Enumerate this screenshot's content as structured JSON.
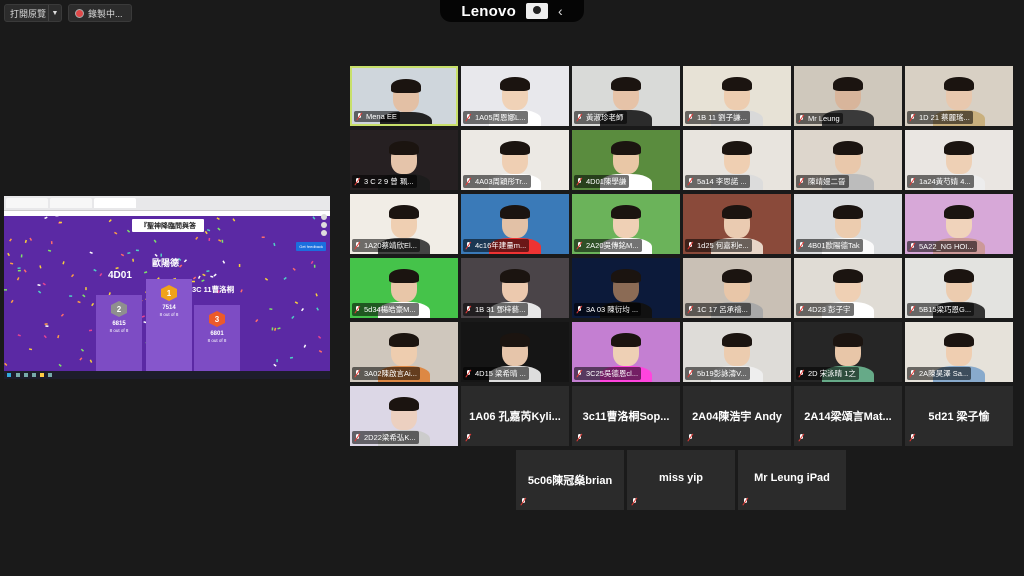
{
  "toolbar": {
    "view_options_label": "打開原覽",
    "recording_label": "錄製中..."
  },
  "lenovo": {
    "brand": "Lenovo"
  },
  "shared_screen": {
    "question": "『聖神降臨問與答",
    "get_feedback": "Get feedback",
    "podiums": [
      {
        "rank": "2",
        "name": "4D01",
        "score": "6815",
        "detail": "8 out of 8",
        "color": "#8f8f8f"
      },
      {
        "rank": "1",
        "name": "歐陽德",
        "score": "7514",
        "detail": "8 out of 8",
        "color": "#f0a21a"
      },
      {
        "rank": "3",
        "name": "3C 11曹洛桐",
        "score": "6801",
        "detail": "8 out of 8",
        "color": "#ec5a2a"
      }
    ]
  },
  "participants": [
    {
      "name": "Mena EE",
      "video": true,
      "active": true,
      "bg": "#cfd6dc",
      "skin": "#e3c0a5",
      "shirt": "#222"
    },
    {
      "name": "1A05周恩娜L...",
      "video": true,
      "bg": "#e8e8ec",
      "skin": "#f0d2b7",
      "shirt": "#fff"
    },
    {
      "name": "黃淑珍老師",
      "video": true,
      "bg": "#d9dad8",
      "skin": "#e6c3a8",
      "shirt": "#2b2b2b"
    },
    {
      "name": "1B 11 劉子謙...",
      "video": true,
      "bg": "#e7e2d6",
      "skin": "#edcdb0",
      "shirt": "#d9d9d9"
    },
    {
      "name": "Mr Leung",
      "video": true,
      "bg": "#cfc8bc",
      "skin": "#d8b59b",
      "shirt": "#3a3a3a"
    },
    {
      "name": "1D 21 蔡麗瑤...",
      "video": true,
      "bg": "#d8d0c4",
      "skin": "#e8c8ae",
      "shirt": "#c9b07e"
    },
    {
      "name": "3 C 2 9 曾 珮...",
      "video": true,
      "bg": "#262022",
      "skin": "#e5c4aa",
      "shirt": "#1c1c1c"
    },
    {
      "name": "4A03周穎彤Tr...",
      "video": true,
      "bg": "#ece9e4",
      "skin": "#efcfb3",
      "shirt": "#fff"
    },
    {
      "name": "4D01陳學謙",
      "video": true,
      "bg": "#5a8c3e",
      "skin": "#e9c7a6",
      "shirt": "#fff"
    },
    {
      "name": "5a14 李思諾 ...",
      "video": true,
      "bg": "#e8e4de",
      "skin": "#efcfb2",
      "shirt": "#dcdcdc"
    },
    {
      "name": "陳靖嫚二晉",
      "video": true,
      "bg": "#ddd6cc",
      "skin": "#e9c8ab",
      "shirt": "#bcbcbc"
    },
    {
      "name": "1a24黃芍婧 4...",
      "video": true,
      "bg": "#eae6e2",
      "skin": "#eed0b5",
      "shirt": "#ededed"
    },
    {
      "name": "1A20蔡靖欣El...",
      "video": true,
      "bg": "#f1ede6",
      "skin": "#efcfb2",
      "shirt": "#444"
    },
    {
      "name": "4c16年建量m...",
      "video": true,
      "bg": "#3a7ab8",
      "skin": "#e2c1a6",
      "shirt": "#e33"
    },
    {
      "name": "2A20吳傳銘M...",
      "video": true,
      "bg": "#6bb35a",
      "skin": "#efd0b5",
      "shirt": "#fff"
    },
    {
      "name": "1d25 何嘉利e...",
      "video": true,
      "bg": "#8a4a3a",
      "skin": "#eacbb1",
      "shirt": "#e8d6c8"
    },
    {
      "name": "4B01歐陽德Tak",
      "video": true,
      "bg": "#dadcde",
      "skin": "#ecccaf",
      "shirt": "#fafafa"
    },
    {
      "name": "5A22_NG HOI...",
      "video": true,
      "bg": "#d7a8d8",
      "skin": "#f0d3bb",
      "shirt": "#c99"
    },
    {
      "name": "5d34楊皓豪M...",
      "video": true,
      "bg": "#45c34a",
      "skin": "#e8c6a8",
      "shirt": "#fff"
    },
    {
      "name": "1B 31 鄧梓藝...",
      "video": true,
      "bg": "#4a4448",
      "skin": "#ecc9ae",
      "shirt": "#e6e6e6"
    },
    {
      "name": "3A 03 陳衍均 ...",
      "video": true,
      "bg": "#0c1a3a",
      "skin": "#8b6b55",
      "shirt": "#111"
    },
    {
      "name": "1C 17 呂承禧...",
      "video": true,
      "bg": "#c9c0b5",
      "skin": "#e8c6a8",
      "shirt": "#a8a8a8"
    },
    {
      "name": "4D23 彭子宇",
      "video": true,
      "bg": "#e0dcd5",
      "skin": "#efd0b4",
      "shirt": "#fff"
    },
    {
      "name": "5B15梁巧恩G...",
      "video": true,
      "bg": "#e3e3e0",
      "skin": "#ecccaf",
      "shirt": "#333"
    },
    {
      "name": "3A02陳啟言Ai...",
      "video": true,
      "bg": "#cfc7bd",
      "skin": "#eecdaf",
      "shirt": "#d84"
    },
    {
      "name": "4D15 梁希晴 ...",
      "video": true,
      "bg": "#151515",
      "skin": "#e6c5aa",
      "shirt": "#ddd"
    },
    {
      "name": "3C25吳德恩cl...",
      "video": true,
      "bg": "#c47fd2",
      "skin": "#eed0b5",
      "shirt": "#f4d"
    },
    {
      "name": "5b19彭詠濤V...",
      "video": true,
      "bg": "#dedcd8",
      "skin": "#ecccaf",
      "shirt": "#eee"
    },
    {
      "name": "2D 宋泳晴 1之",
      "video": true,
      "bg": "#262626",
      "skin": "#e8c6a8",
      "shirt": "#6a8"
    },
    {
      "name": "2A陳昊澤 Sa...",
      "video": true,
      "bg": "#e6e2da",
      "skin": "#efceb1",
      "shirt": "#8ac"
    },
    {
      "name": "2D22梁希弘K...",
      "video": true,
      "bg": "#dcd7e6",
      "skin": "#ecd0c0",
      "shirt": "#ccc"
    },
    {
      "name": "1A06 孔嘉芮Kyli...",
      "video": false
    },
    {
      "name": "3c11曹洛桐Sop...",
      "video": false
    },
    {
      "name": "2A04陳浩宇 Andy",
      "video": false
    },
    {
      "name": "2A14梁頌言Mat...",
      "video": false
    },
    {
      "name": "5d21 梁子愉",
      "video": false
    },
    {
      "name": "5c06陳冠燊brian",
      "video": false
    },
    {
      "name": "miss yip",
      "video": false
    },
    {
      "name": "Mr Leung iPad",
      "video": false
    }
  ]
}
